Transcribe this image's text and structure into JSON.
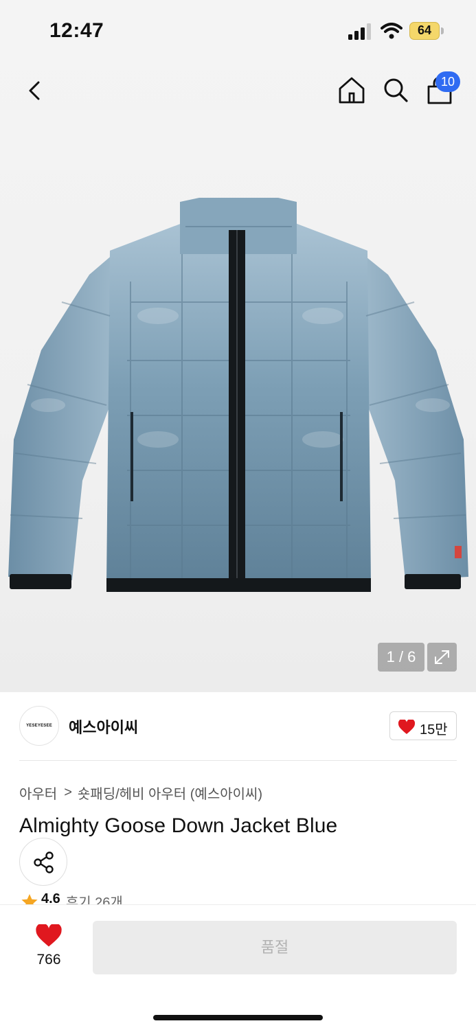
{
  "status_bar": {
    "time": "12:47",
    "battery": "64"
  },
  "nav": {
    "cart_count": "10"
  },
  "gallery": {
    "indicator": "1 / 6"
  },
  "brand": {
    "logo_text": "YESEYESEE",
    "name": "예스아이씨",
    "like_count": "15만"
  },
  "breadcrumb": {
    "level1": "아우터",
    "separator": ">",
    "level2": "숏패딩/헤비 아우터 (예스아이씨)"
  },
  "product": {
    "title": "Almighty Goose Down Jacket Blue",
    "rating": "4.6",
    "reviews": "후기 26개"
  },
  "bottom_bar": {
    "wish_count": "766",
    "buy_label": "품절"
  },
  "colors": {
    "accent": "#2f6bf2",
    "heart": "#e0181f",
    "star": "#f5a623",
    "jacket": "#7fa0b7",
    "disabled_bg": "#ebebeb"
  }
}
